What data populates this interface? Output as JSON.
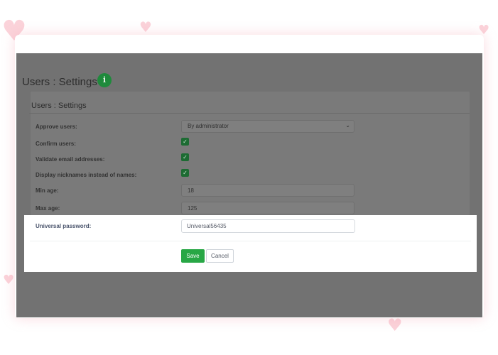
{
  "page": {
    "title": "Users : Settings",
    "info_icon": "info-icon"
  },
  "panel": {
    "header": "Users : Settings",
    "approve_users": {
      "label": "Approve users:",
      "value": "By administrator",
      "icon": "chevron-down-icon"
    },
    "confirm_users": {
      "label": "Confirm users:",
      "checked": true
    },
    "validate_email": {
      "label": "Validate email addresses:",
      "checked": true
    },
    "display_nicknames": {
      "label": "Display nicknames instead of names:",
      "checked": true
    },
    "min_age": {
      "label": "Min age:",
      "value": "18"
    },
    "max_age": {
      "label": "Max age:",
      "value": "125"
    },
    "universal_password": {
      "label": "Universal password:",
      "value": "Universal56435"
    }
  },
  "actions": {
    "save_label": "Save",
    "cancel_label": "Cancel"
  },
  "colors": {
    "accent": "#28a745",
    "overlay": "#727272",
    "heart": "#fbd3da"
  }
}
